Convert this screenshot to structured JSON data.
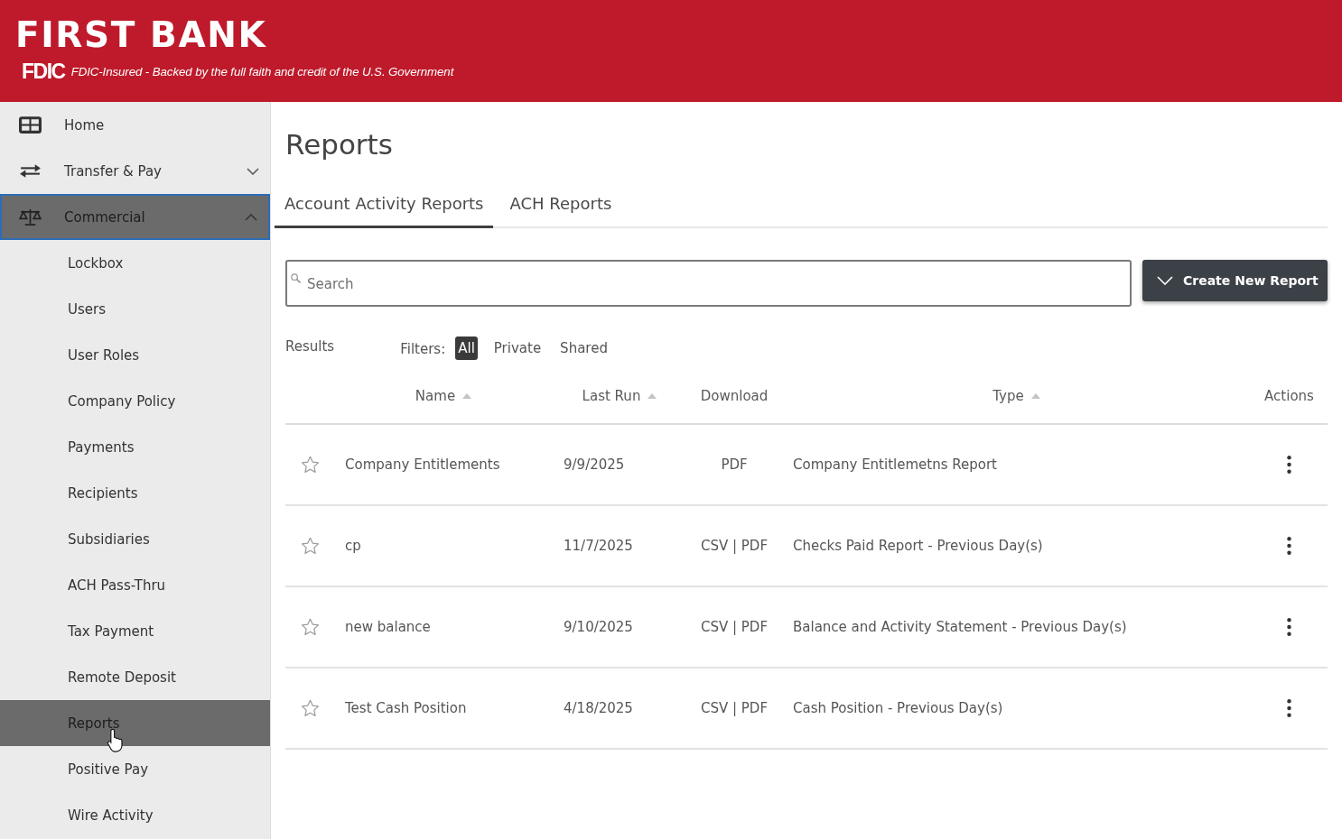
{
  "header": {
    "bank_name": "FIRST BANK",
    "fdic_mark": "FDIC",
    "fdic_notice": "FDIC-Insured - Backed by the full faith and credit of the U.S. Government"
  },
  "sidebar": {
    "items": [
      {
        "label": "Home",
        "selected": false
      },
      {
        "label": "Transfer & Pay",
        "selected": false,
        "expanded": false
      },
      {
        "label": "Commercial",
        "selected": true,
        "expanded": true,
        "children": [
          {
            "label": "Lockbox",
            "selected": false
          },
          {
            "label": "Users",
            "selected": false
          },
          {
            "label": "User Roles",
            "selected": false
          },
          {
            "label": "Company Policy",
            "selected": false
          },
          {
            "label": "Payments",
            "selected": false
          },
          {
            "label": "Recipients",
            "selected": false
          },
          {
            "label": "Subsidiaries",
            "selected": false
          },
          {
            "label": "ACH Pass-Thru",
            "selected": false
          },
          {
            "label": "Tax Payment",
            "selected": false
          },
          {
            "label": "Remote Deposit",
            "selected": false
          },
          {
            "label": "Reports",
            "selected": true
          },
          {
            "label": "Positive Pay",
            "selected": false
          },
          {
            "label": "Wire Activity",
            "selected": false
          }
        ]
      }
    ]
  },
  "page": {
    "title": "Reports"
  },
  "tabs": [
    {
      "label": "Account Activity Reports",
      "selected": true
    },
    {
      "label": "ACH Reports",
      "selected": false
    }
  ],
  "search": {
    "placeholder": "Search"
  },
  "create_button": {
    "label": "Create New Report"
  },
  "results_label": "Results",
  "filters": {
    "label": "Filters:",
    "options": [
      {
        "label": "All",
        "selected": true
      },
      {
        "label": "Private",
        "selected": false
      },
      {
        "label": "Shared",
        "selected": false
      }
    ]
  },
  "table": {
    "columns": [
      {
        "label": "Name",
        "sortable": true
      },
      {
        "label": "Last Run",
        "sortable": true
      },
      {
        "label": "Download",
        "sortable": false
      },
      {
        "label": "Type",
        "sortable": true
      },
      {
        "label": "Actions",
        "sortable": false
      }
    ],
    "rows": [
      {
        "starred": false,
        "name": "Company Entitlements",
        "last_run": "9/9/2025",
        "download": "PDF",
        "type": "Company Entitlemetns Report"
      },
      {
        "starred": false,
        "name": "cp",
        "last_run": "11/7/2025",
        "download": "CSV | PDF",
        "type": "Checks Paid Report - Previous Day(s)"
      },
      {
        "starred": false,
        "name": "new balance",
        "last_run": "9/10/2025",
        "download": "CSV | PDF",
        "type": "Balance and Activity Statement - Previous Day(s)"
      },
      {
        "starred": false,
        "name": "Test Cash Position",
        "last_run": "4/18/2025",
        "download": "CSV | PDF",
        "type": "Cash Position - Previous Day(s)"
      }
    ]
  }
}
